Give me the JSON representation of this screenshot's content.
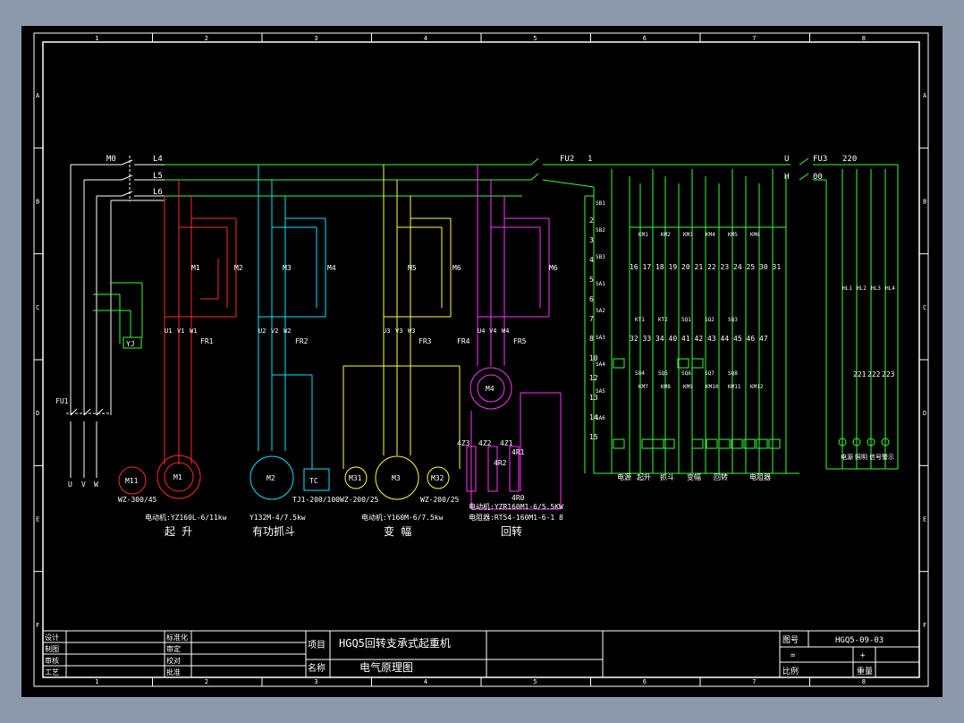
{
  "colors": {
    "background": "#000000",
    "frame": "#ffffff",
    "red": "#ff2a2a",
    "cyan": "#00e5ff",
    "yellow": "#ffff33",
    "magenta": "#ff33ff",
    "green": "#33ff33",
    "blue": "#3377ff"
  },
  "grid": {
    "columns": [
      "1",
      "2",
      "3",
      "4",
      "5",
      "6",
      "7",
      "8"
    ],
    "rows": [
      "A",
      "B",
      "C",
      "D",
      "E",
      "F"
    ]
  },
  "bus_labels": [
    "M0",
    "L4",
    "L5",
    "L6",
    "FU2",
    "1",
    "U",
    "FU3",
    "220",
    "H",
    "00"
  ],
  "motors": [
    {
      "id": "M1",
      "label": "M1"
    },
    {
      "id": "M2",
      "label": "M2"
    },
    {
      "id": "M3",
      "label": "M3"
    },
    {
      "id": "M4",
      "label": "M4"
    },
    {
      "id": "M11",
      "label": "M11"
    },
    {
      "id": "M31",
      "label": "M31"
    },
    {
      "id": "M32",
      "label": "M32"
    },
    {
      "id": "TC",
      "label": "TC"
    }
  ],
  "contactor_labels": [
    "M1",
    "M2",
    "M3",
    "M4",
    "M5",
    "M6",
    "M6"
  ],
  "relay_labels": [
    "FR1",
    "FR2",
    "FR3",
    "FR4",
    "FR5"
  ],
  "terminal_labels": [
    "U1",
    "V1",
    "W1",
    "U2",
    "V2",
    "W2",
    "U3",
    "V3",
    "W3",
    "U4",
    "V4",
    "W4"
  ],
  "small_labels": [
    "YJ",
    "FU1",
    "U",
    "V",
    "W",
    "1",
    "2",
    "3"
  ],
  "resistor_labels": [
    "4Z3",
    "4Z2",
    "4Z1",
    "4R2",
    "4R1",
    "4R0"
  ],
  "group_captions": {
    "hoist_model": "WZ-300/45",
    "hoist_motor": "电动机:YZ160L-6/11kw",
    "hoist_name": "起 升",
    "grab_motor": "Y132M-4/7.5kw",
    "grab_tc": "TJ1-200/100",
    "grab_name": "有功抓斗",
    "luff_model1": "WZ-200/25",
    "luff_model2": "WZ-200/25",
    "luff_motor": "电动机:Y160M-6/7.5kw",
    "luff_name": "变 幅",
    "slew_motor": "电动机:YZR160M1-6/5.5KW",
    "slew_resistor": "电阻器:RT54-160M1-6-1 8",
    "slew_name": "回转"
  },
  "control_numbers": [
    "2",
    "3",
    "4",
    "5",
    "6",
    "7",
    "8",
    "10",
    "12",
    "13",
    "14",
    "15",
    "16",
    "17",
    "18",
    "19",
    "20",
    "21",
    "22",
    "23",
    "24",
    "25",
    "30",
    "31",
    "32",
    "33",
    "34",
    "40",
    "41",
    "42",
    "43",
    "44",
    "45",
    "46",
    "47",
    "221",
    "222",
    "223"
  ],
  "control_labels": [
    "SB1",
    "SB2",
    "SB3",
    "SA1",
    "SA2",
    "SA3",
    "SA4",
    "SA5",
    "SA6",
    "KM1",
    "KM2",
    "KM3",
    "KM4",
    "KM5",
    "KM6",
    "KM7",
    "KM8",
    "KM9",
    "KM10",
    "KM11",
    "KM12",
    "KT1",
    "KT2",
    "SQ1",
    "SQ2",
    "SQ3",
    "SQ4",
    "SQ5",
    "SQ6",
    "SQ7",
    "SQ8",
    "HL1",
    "HL2",
    "HL3",
    "HL4"
  ],
  "control_captions": [
    "电源",
    "起升",
    "抓斗",
    "变幅",
    "回转",
    "电阻器"
  ],
  "lamp_captions": [
    "电源",
    "照明",
    "信号",
    "警示"
  ],
  "title_block": {
    "left_rows": [
      [
        "设计",
        "",
        "标准化",
        ""
      ],
      [
        "制图",
        "",
        "审定",
        ""
      ],
      [
        "审核",
        "",
        "校对",
        ""
      ],
      [
        "工艺",
        "",
        "批准",
        ""
      ]
    ],
    "project_label": "项目",
    "project_value": "HGQ5回转支承式起重机",
    "name_label": "名称",
    "name_value": "电气原理图",
    "drawing_no_label": "图号",
    "drawing_no_value": "HGQ5-09-03",
    "scale_label": "比例",
    "weight_label": "重量",
    "scale_value": "=",
    "sheet_value": "+"
  }
}
